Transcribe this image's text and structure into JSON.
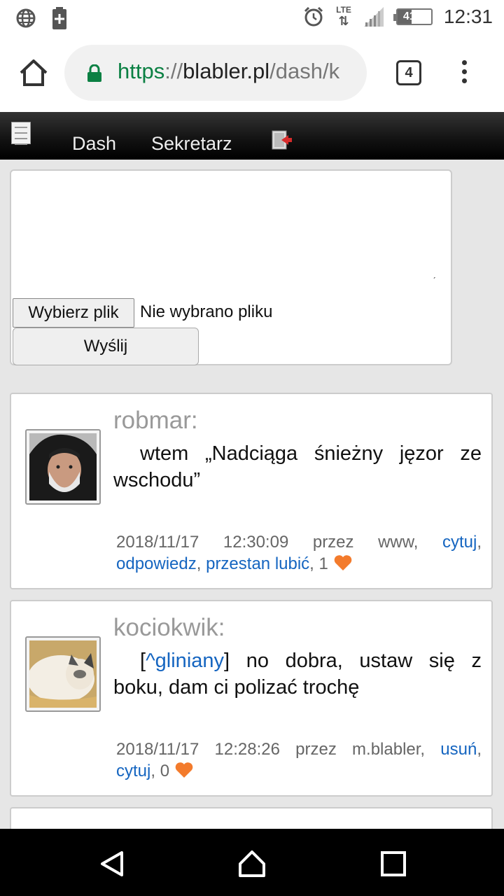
{
  "status_bar": {
    "time": "12:31",
    "battery_percent": "41%",
    "battery_level": 0.41,
    "network": "LTE",
    "icons": [
      "globe-icon",
      "battery-saver-icon",
      "alarm-icon",
      "lte-data-icon",
      "signal-icon",
      "battery-icon"
    ]
  },
  "browser": {
    "url_scheme": "https",
    "url_separator": "://",
    "url_host": "blabler.pl",
    "url_path": "/dash/k",
    "tab_count": "4"
  },
  "site_nav": {
    "items": [
      "Dash",
      "Sekretarz"
    ]
  },
  "compose": {
    "file_button": "Wybierz plik",
    "file_status": "Nie wybrano pliku",
    "send_button": "Wyślij"
  },
  "posts": [
    {
      "author": "robmar:",
      "text": "wtem „Nadciąga śnieżny jęzor ze wschodu”",
      "datetime": "2018/11/17 12:30:09",
      "via": "przez www,",
      "actions": [
        "cytuj",
        "odpowiedz",
        "przestan lubić"
      ],
      "likes": "1"
    },
    {
      "author": "kociokwik:",
      "mention": "^gliniany",
      "text": " no dobra, ustaw się z boku, dam ci polizać trochę",
      "datetime": "2018/11/17 12:28:26",
      "via": "przez m.blabler,",
      "actions": [
        "usuń",
        "cytuj"
      ],
      "likes": "0"
    }
  ],
  "colors": {
    "accent_link": "#1565c0",
    "heart": "#f37b2c",
    "url_scheme_green": "#0b8043"
  }
}
